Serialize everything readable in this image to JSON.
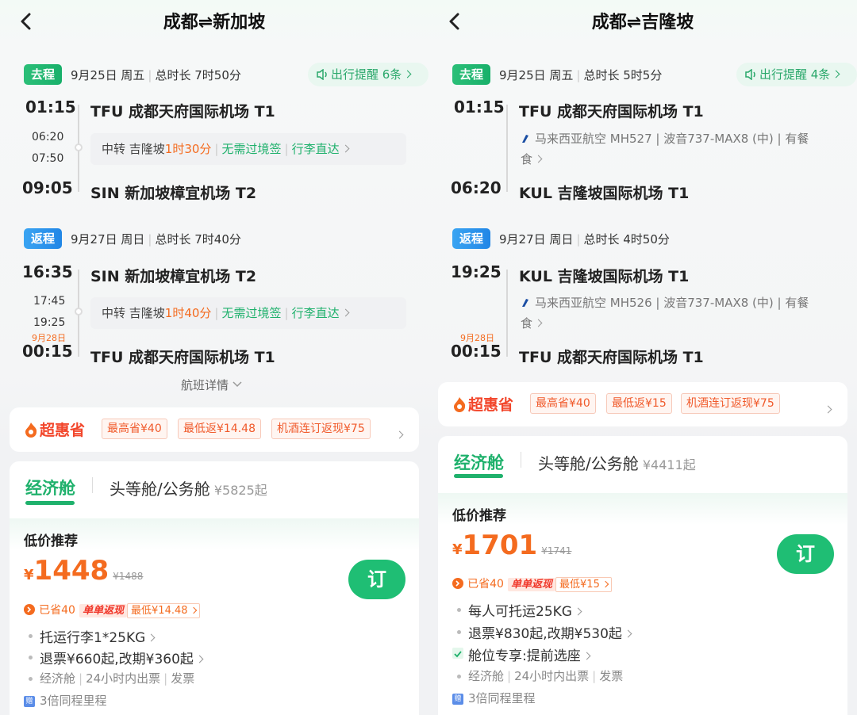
{
  "left": {
    "title": "成都⇌新加坡",
    "outbound": {
      "tag": "去程",
      "date": "9月25日 周五",
      "duration": "总时长 7时50分",
      "reminder": "出行提醒 6条",
      "dep_time": "01:15",
      "dep_airport": "TFU 成都天府国际机场 T1",
      "stop_arr": "06:20",
      "stop_dep": "07:50",
      "transfer_city": "中转 吉隆坡",
      "transfer_time": "1时30分",
      "visa": "无需过境签",
      "baggage": "行李直达",
      "arr_time": "09:05",
      "arr_airport": "SIN 新加坡樟宜机场 T2"
    },
    "return": {
      "tag": "返程",
      "date": "9月27日 周日",
      "duration": "总时长 7时40分",
      "dep_time": "16:35",
      "dep_airport": "SIN 新加坡樟宜机场 T2",
      "stop_arr": "17:45",
      "stop_dep": "19:25",
      "transfer_city": "中转 吉隆坡",
      "transfer_time": "1时40分",
      "visa": "无需过境签",
      "baggage": "行李直达",
      "next_day": "9月28日",
      "arr_time": "00:15",
      "arr_airport": "TFU 成都天府国际机场 T1"
    },
    "details_link": "航班详情",
    "promo": {
      "logo": "超惠省",
      "chips": [
        "最高省¥40",
        "最低返¥14.48",
        "机酒连订返现¥75"
      ]
    },
    "tabs": {
      "economy": "经济舱",
      "first": "头等舱/公务舱",
      "first_price": "¥5825起"
    },
    "offer": {
      "label": "低价推荐",
      "yen": "¥",
      "price": "1448",
      "old_price": "¥1488",
      "book": "订",
      "saved": "已省40",
      "cashback": "单单返现",
      "lowest": "最低¥14.48",
      "features": [
        "托运行李1*25KG",
        "退票¥660起,改期¥360起"
      ],
      "info": [
        "经济舱",
        "24小时内出票",
        "发票"
      ],
      "mileage": "3倍同程里程"
    }
  },
  "right": {
    "title": "成都⇌吉隆坡",
    "outbound": {
      "tag": "去程",
      "date": "9月25日 周五",
      "duration": "总时长 5时5分",
      "reminder": "出行提醒 4条",
      "dep_time": "01:15",
      "dep_airport": "TFU 成都天府国际机场 T1",
      "airline_l1": "马来西亚航空 MH527 | 波音737-MAX8 (中) | 有餐",
      "airline_l2": "食",
      "arr_time": "06:20",
      "arr_airport": "KUL 吉隆坡国际机场 T1"
    },
    "return": {
      "tag": "返程",
      "date": "9月27日 周日",
      "duration": "总时长 4时50分",
      "dep_time": "19:25",
      "dep_airport": "KUL 吉隆坡国际机场 T1",
      "airline_l1": "马来西亚航空 MH526 | 波音737-MAX8 (中) | 有餐",
      "airline_l2": "食",
      "next_day": "9月28日",
      "arr_time": "00:15",
      "arr_airport": "TFU 成都天府国际机场 T1"
    },
    "promo": {
      "logo": "超惠省",
      "chips": [
        "最高省¥40",
        "最低返¥15",
        "机酒连订返现¥75"
      ]
    },
    "tabs": {
      "economy": "经济舱",
      "first": "头等舱/公务舱",
      "first_price": "¥4411起"
    },
    "offer": {
      "label": "低价推荐",
      "yen": "¥",
      "price": "1701",
      "old_price": "¥1741",
      "book": "订",
      "saved": "已省40",
      "cashback": "单单返现",
      "lowest": "最低¥15",
      "features": [
        "每人可托运25KG",
        "退票¥830起,改期¥530起",
        "舱位专享:提前选座"
      ],
      "info": [
        "经济舱",
        "24小时内出票",
        "发票"
      ],
      "mileage": "3倍同程里程"
    }
  }
}
